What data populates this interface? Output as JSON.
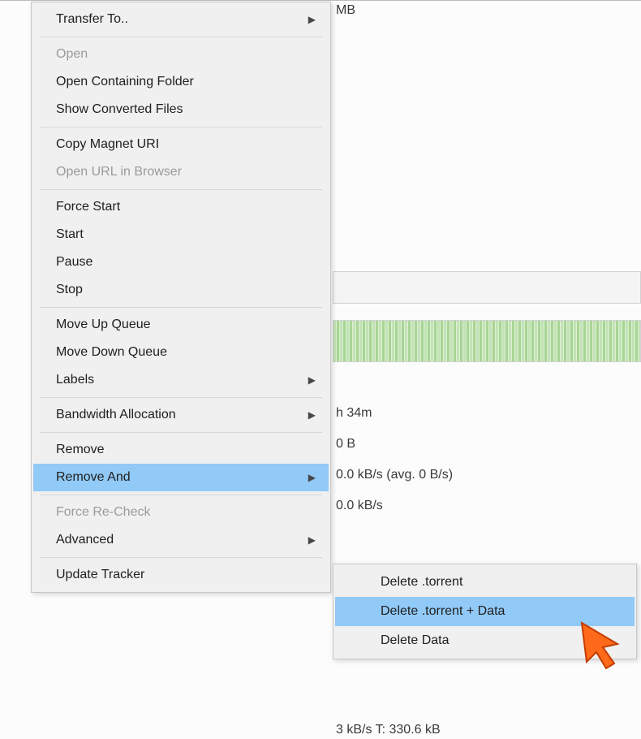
{
  "menu": {
    "transfer_to": "Transfer To..",
    "open": "Open",
    "open_containing": "Open Containing Folder",
    "show_converted": "Show Converted Files",
    "copy_magnet": "Copy Magnet URI",
    "open_url": "Open URL in Browser",
    "force_start": "Force Start",
    "start": "Start",
    "pause": "Pause",
    "stop": "Stop",
    "move_up": "Move Up Queue",
    "move_down": "Move Down Queue",
    "labels": "Labels",
    "bandwidth": "Bandwidth Allocation",
    "remove": "Remove",
    "remove_and": "Remove And",
    "force_recheck": "Force Re-Check",
    "advanced": "Advanced",
    "update_tracker": "Update Tracker"
  },
  "submenu": {
    "delete_torrent": "Delete .torrent",
    "delete_torrent_data": "Delete .torrent + Data",
    "delete_data": "Delete Data"
  },
  "bg": {
    "topfrag": "MB",
    "eta": "h 34m",
    "uploaded": "0 B",
    "dlspeed": "0.0 kB/s (avg. 0 B/s)",
    "upspeed": "0.0 kB/s",
    "bottomfrag": "3 kB/s T: 330.6 kB"
  }
}
